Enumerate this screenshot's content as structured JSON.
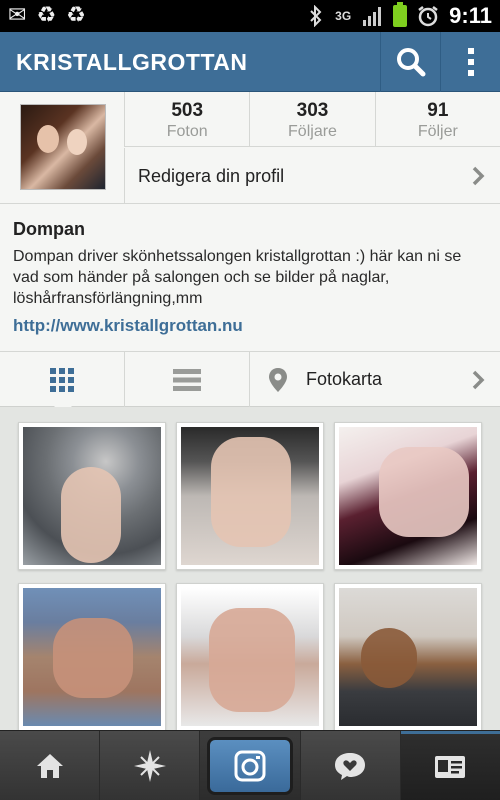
{
  "status_bar": {
    "time": "9:11",
    "network": "3G"
  },
  "header": {
    "title": "KRISTALLGROTTAN"
  },
  "profile": {
    "stats": [
      {
        "num": "503",
        "label": "Foton"
      },
      {
        "num": "303",
        "label": "Följare"
      },
      {
        "num": "91",
        "label": "Följer"
      }
    ],
    "edit_label": "Redigera din profil"
  },
  "bio": {
    "name": "Dompan",
    "text": "Dompan driver skönhetssalongen kristallgrottan :)  här kan ni se vad som händer på salongen och se bilder på naglar, löshårfransförlängning,mm",
    "link": "http://www.kristallgrottan.nu"
  },
  "tabs": {
    "map_label": "Fotokarta"
  },
  "colors": {
    "brand": "#3e6e97",
    "header": "#3e6e97",
    "tab_active": "#3e6e97"
  }
}
